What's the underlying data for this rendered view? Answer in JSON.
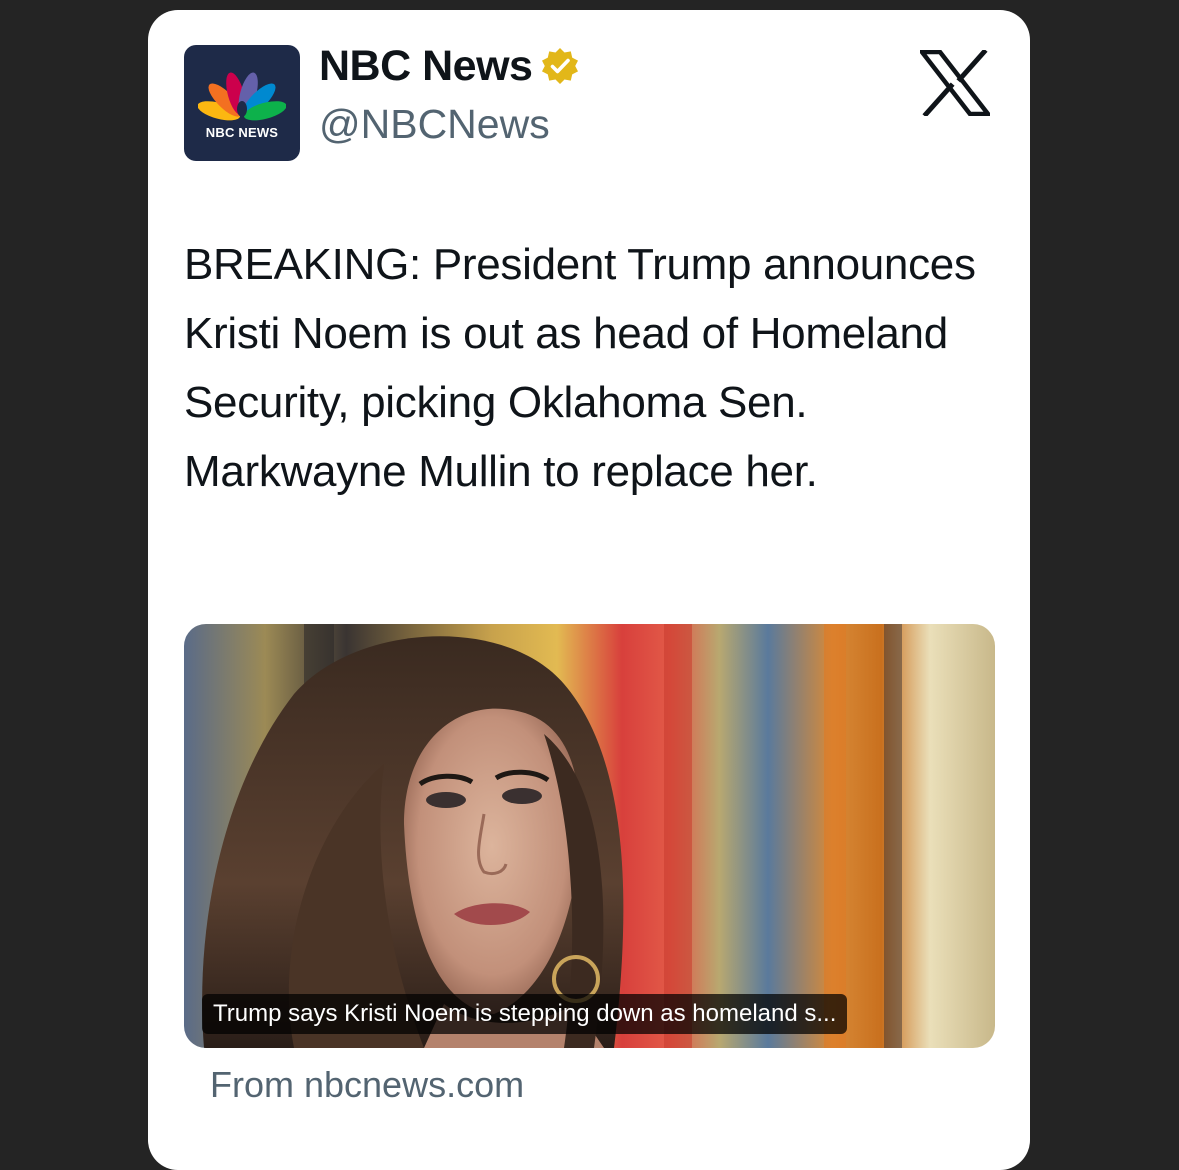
{
  "account": {
    "display_name": "NBC News",
    "handle": "@NBCNews",
    "avatar_text": "NBC NEWS",
    "verified": true,
    "verified_color": "#e2b719"
  },
  "platform_icon": "x-logo-icon",
  "tweet": {
    "text": "BREAKING: President Trump announces Kristi Noem is out as head of Homeland Security, picking Oklahoma Sen. Markwayne Mullin to replace her."
  },
  "link_card": {
    "image_icon": "portrait-photo",
    "caption": "Trump says Kristi Noem is stepping down as homeland s...",
    "source": "From nbcnews.com"
  },
  "colors": {
    "page_background": "#242424",
    "card_background": "#ffffff",
    "primary_text": "#0f1419",
    "secondary_text": "#536471"
  }
}
